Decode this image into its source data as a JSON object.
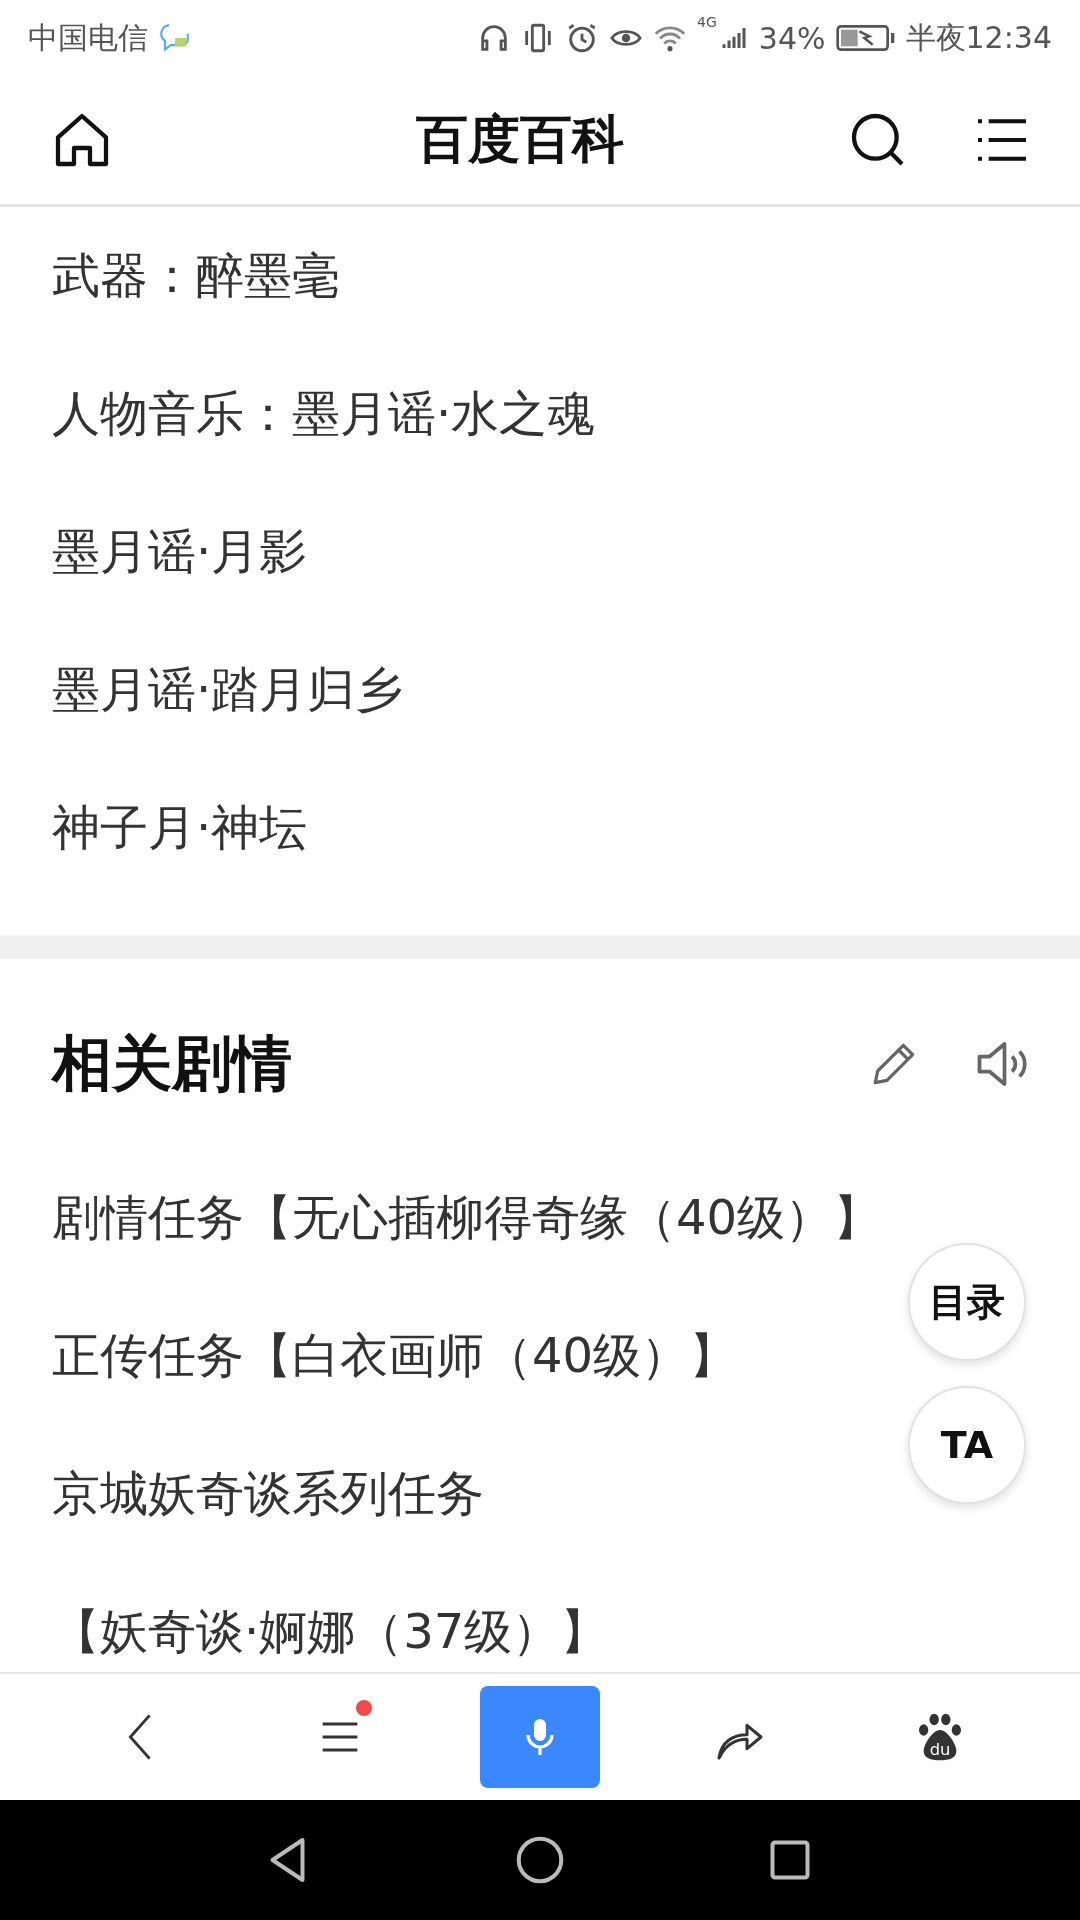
{
  "status_bar": {
    "carrier": "中国电信",
    "battery": "34%",
    "network": "4G",
    "time": "半夜12:34"
  },
  "header": {
    "title": "百度百科"
  },
  "info_lines": [
    "武器：醉墨毫",
    "人物音乐：墨月谣·水之魂",
    "墨月谣·月影",
    "墨月谣·踏月归乡",
    "神子月·神坛"
  ],
  "section": {
    "title": "相关剧情",
    "items": [
      "剧情任务【无心插柳得奇缘（40级）】",
      "正传任务【白衣画师（40级）】",
      "京城妖奇谈系列任务",
      "【妖奇谈·婀娜（37级）】"
    ]
  },
  "floating_buttons": [
    {
      "label": "目录"
    },
    {
      "label": "TA"
    }
  ],
  "toolbar": {
    "menu_has_notification": true,
    "items": [
      {
        "kind": "back",
        "selected": false
      },
      {
        "kind": "menu",
        "selected": false
      },
      {
        "kind": "voice",
        "selected": true
      },
      {
        "kind": "share",
        "selected": false
      },
      {
        "kind": "paw",
        "selected": false,
        "logo_text": "du"
      }
    ]
  }
}
